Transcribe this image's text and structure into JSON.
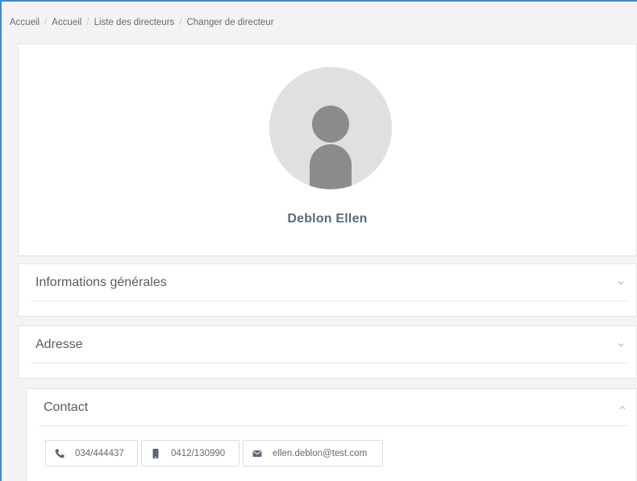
{
  "breadcrumb": {
    "items": [
      "Accueil",
      "Accueil",
      "Liste des directeurs",
      "Changer de directeur"
    ],
    "separator": "/"
  },
  "profile": {
    "name": "Deblon Ellen",
    "avatar_icon": "user-placeholder-icon"
  },
  "sections": {
    "info": {
      "title": "Informations générales",
      "state": "collapsed"
    },
    "address": {
      "title": "Adresse",
      "state": "collapsed"
    },
    "contact": {
      "title": "Contact",
      "state": "expanded"
    }
  },
  "contact": {
    "phone": "034/444437",
    "mobile": "0412/130990",
    "email": "ellen.deblon@test.com"
  },
  "colors": {
    "accent_border": "#4a86c8",
    "name_color": "#586b82",
    "icon_color": "#5a6775"
  }
}
